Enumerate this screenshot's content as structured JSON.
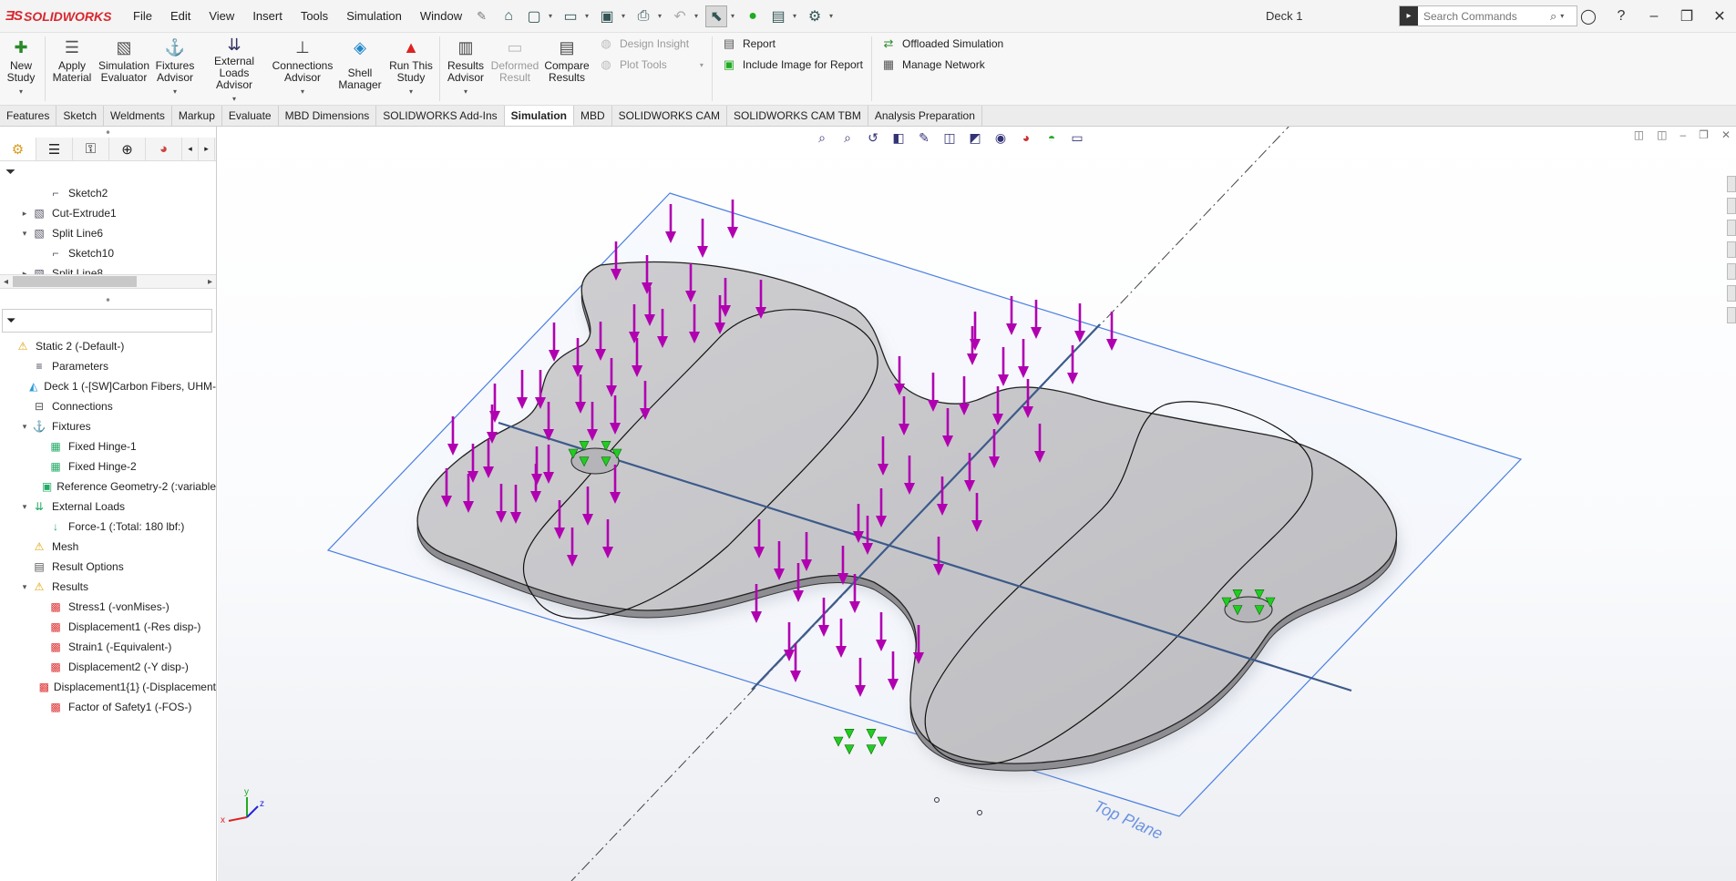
{
  "app": {
    "logo": "SOLIDWORKS",
    "document_title": "Deck 1"
  },
  "menu": [
    "File",
    "Edit",
    "View",
    "Insert",
    "Tools",
    "Simulation",
    "Window"
  ],
  "search": {
    "placeholder": "Search Commands"
  },
  "ribbon": {
    "new_study": "New\nStudy",
    "apply_material": "Apply\nMaterial",
    "simulation_evaluator": "Simulation\nEvaluator",
    "fixtures_advisor": "Fixtures\nAdvisor",
    "external_loads_advisor": "External Loads\nAdvisor",
    "connections_advisor": "Connections\nAdvisor",
    "shell_manager": "Shell\nManager",
    "run_this_study": "Run This\nStudy",
    "results_advisor": "Results\nAdvisor",
    "deformed_result": "Deformed\nResult",
    "compare_results": "Compare\nResults",
    "design_insight": "Design Insight",
    "plot_tools": "Plot Tools",
    "report": "Report",
    "include_image": "Include Image for Report",
    "offloaded_simulation": "Offloaded Simulation",
    "manage_network": "Manage Network"
  },
  "tabs": [
    "Features",
    "Sketch",
    "Weldments",
    "Markup",
    "Evaluate",
    "MBD Dimensions",
    "SOLIDWORKS Add-Ins",
    "Simulation",
    "MBD",
    "SOLIDWORKS CAM",
    "SOLIDWORKS CAM TBM",
    "Analysis Preparation"
  ],
  "active_tab": "Simulation",
  "feature_tree": [
    {
      "label": "Sketch2",
      "indent": 2,
      "expander": ""
    },
    {
      "label": "Cut-Extrude1",
      "indent": 1,
      "expander": "▸"
    },
    {
      "label": "Split Line6",
      "indent": 1,
      "expander": "▾"
    },
    {
      "label": "Sketch10",
      "indent": 2,
      "expander": ""
    },
    {
      "label": "Split Line8",
      "indent": 1,
      "expander": "▸"
    }
  ],
  "study_tree": [
    {
      "label": "Static 2 (-Default-)",
      "indent": 0,
      "expander": "",
      "icon": "warning-icon"
    },
    {
      "label": "Parameters",
      "indent": 1,
      "expander": "",
      "icon": "parameters-icon"
    },
    {
      "label": "Deck 1 (-[SW]Carbon Fibers, UHM-",
      "indent": 1,
      "expander": "",
      "icon": "part-icon"
    },
    {
      "label": "Connections",
      "indent": 1,
      "expander": "",
      "icon": "connections-icon"
    },
    {
      "label": "Fixtures",
      "indent": 1,
      "expander": "▾",
      "icon": "fixtures-icon"
    },
    {
      "label": "Fixed Hinge-1",
      "indent": 2,
      "expander": "",
      "icon": "hinge-icon"
    },
    {
      "label": "Fixed Hinge-2",
      "indent": 2,
      "expander": "",
      "icon": "hinge-icon"
    },
    {
      "label": "Reference Geometry-2 (:variable",
      "indent": 2,
      "expander": "",
      "icon": "reference-geometry-icon"
    },
    {
      "label": "External Loads",
      "indent": 1,
      "expander": "▾",
      "icon": "external-loads-icon"
    },
    {
      "label": "Force-1 (:Total: 180 lbf:)",
      "indent": 2,
      "expander": "",
      "icon": "force-icon"
    },
    {
      "label": "Mesh",
      "indent": 1,
      "expander": "",
      "icon": "mesh-warning-icon"
    },
    {
      "label": "Result Options",
      "indent": 1,
      "expander": "",
      "icon": "result-options-icon"
    },
    {
      "label": "Results",
      "indent": 1,
      "expander": "▾",
      "icon": "results-warning-icon"
    },
    {
      "label": "Stress1 (-vonMises-)",
      "indent": 2,
      "expander": "",
      "icon": "plot-icon"
    },
    {
      "label": "Displacement1 (-Res disp-)",
      "indent": 2,
      "expander": "",
      "icon": "plot-icon"
    },
    {
      "label": "Strain1 (-Equivalent-)",
      "indent": 2,
      "expander": "",
      "icon": "plot-icon"
    },
    {
      "label": "Displacement2 (-Y disp-)",
      "indent": 2,
      "expander": "",
      "icon": "plot-icon"
    },
    {
      "label": "Displacement1{1} (-Displacement",
      "indent": 2,
      "expander": "",
      "icon": "plot-icon"
    },
    {
      "label": "Factor of Safety1 (-FOS-)",
      "indent": 2,
      "expander": "",
      "icon": "plot-icon"
    }
  ],
  "viewport": {
    "plane_label": "Top Plane",
    "triad": {
      "x": "x",
      "y": "y",
      "z": "z"
    }
  },
  "colors": {
    "accent": "#d8272e",
    "force_arrow": "#b000b0",
    "fixture": "#22cc22",
    "plane": "#4a7fe0",
    "part": "#c9c9cc"
  }
}
